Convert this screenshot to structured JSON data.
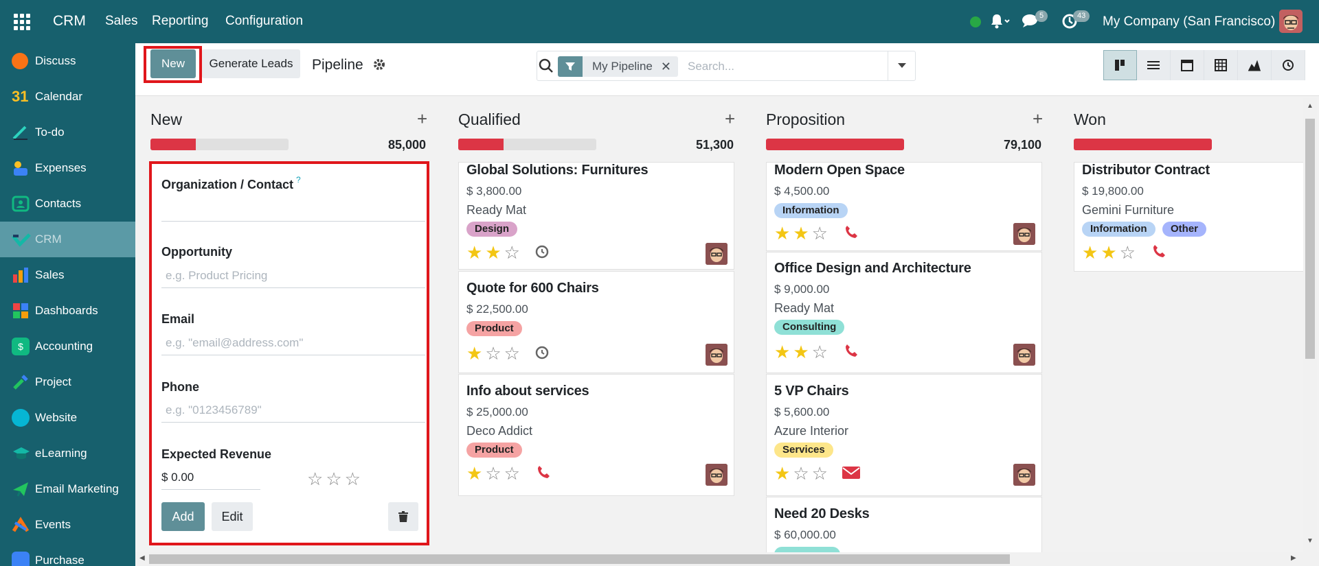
{
  "topbar": {
    "brand": "CRM",
    "menu": [
      "Sales",
      "Reporting",
      "Configuration"
    ],
    "messages_count": "5",
    "activities_count": "43",
    "company": "My Company (San Francisco)"
  },
  "sidebar": {
    "items": [
      {
        "label": "Discuss",
        "icon": "discuss-icon",
        "color": "#f97316"
      },
      {
        "label": "Calendar",
        "icon": "calendar-icon",
        "color": "#1d4ed8"
      },
      {
        "label": "To-do",
        "icon": "todo-icon",
        "color": "#14b8a6"
      },
      {
        "label": "Expenses",
        "icon": "expenses-icon",
        "color": "#3b82f6"
      },
      {
        "label": "Contacts",
        "icon": "contacts-icon",
        "color": "#10b981"
      },
      {
        "label": "CRM",
        "icon": "crm-icon",
        "color": "#14b8a6"
      },
      {
        "label": "Sales",
        "icon": "sales-icon",
        "color": "#ef4444"
      },
      {
        "label": "Dashboards",
        "icon": "dashboards-icon",
        "color": "#3b82f6"
      },
      {
        "label": "Accounting",
        "icon": "accounting-icon",
        "color": "#10b981"
      },
      {
        "label": "Project",
        "icon": "project-icon",
        "color": "#22c55e"
      },
      {
        "label": "Website",
        "icon": "website-icon",
        "color": "#06b6d4"
      },
      {
        "label": "eLearning",
        "icon": "elearning-icon",
        "color": "#14b8a6"
      },
      {
        "label": "Email Marketing",
        "icon": "email-marketing-icon",
        "color": "#22c55e"
      },
      {
        "label": "Events",
        "icon": "events-icon",
        "color": "#f97316"
      },
      {
        "label": "Purchase",
        "icon": "purchase-icon",
        "color": "#3b82f6"
      }
    ],
    "active": "CRM"
  },
  "control": {
    "new_label": "New",
    "generate_label": "Generate Leads",
    "breadcrumb": "Pipeline",
    "filter_label": "My Pipeline",
    "search_placeholder": "Search...",
    "views": [
      "kanban-view-icon",
      "list-view-icon",
      "calendar-view-icon",
      "pivot-view-icon",
      "graph-view-icon",
      "activity-view-icon"
    ]
  },
  "columns": [
    {
      "title": "New",
      "total": "85,000",
      "progress": 0.33
    },
    {
      "title": "Qualified",
      "total": "51,300",
      "progress": 0.33
    },
    {
      "title": "Proposition",
      "total": "79,100",
      "progress": 1.0
    },
    {
      "title": "Won",
      "progress": 1.0
    }
  ],
  "quick_create": {
    "org_label": "Organization / Contact",
    "org_help": "?",
    "opportunity_label": "Opportunity",
    "opportunity_placeholder": "e.g. Product Pricing",
    "email_label": "Email",
    "email_placeholder": "e.g. \"email@address.com\"",
    "phone_label": "Phone",
    "phone_placeholder": "e.g. \"0123456789\"",
    "revenue_label": "Expected Revenue",
    "revenue_value": "$ 0.00",
    "add_label": "Add",
    "edit_label": "Edit"
  },
  "cards": {
    "qualified": [
      {
        "title": "Global Solutions: Furnitures",
        "amount": "$ 3,800.00",
        "customer": "Ready Mat",
        "tags": [
          {
            "label": "Design",
            "color": "#d9a3c9"
          }
        ],
        "stars": 2,
        "activity": "clock"
      },
      {
        "title": "Quote for 600 Chairs",
        "amount": "$ 22,500.00",
        "tags": [
          {
            "label": "Product",
            "color": "#f5a3a3"
          }
        ],
        "stars": 1,
        "activity": "clock"
      },
      {
        "title": "Info about services",
        "amount": "$ 25,000.00",
        "customer": "Deco Addict",
        "tags": [
          {
            "label": "Product",
            "color": "#f5a3a3"
          }
        ],
        "stars": 1,
        "activity": "phone"
      }
    ],
    "proposition": [
      {
        "title": "Modern Open Space",
        "amount": "$ 4,500.00",
        "tags": [
          {
            "label": "Information",
            "color": "#b8d4f5"
          }
        ],
        "stars": 2,
        "activity": "phone"
      },
      {
        "title": "Office Design and Architecture",
        "amount": "$ 9,000.00",
        "customer": "Ready Mat",
        "tags": [
          {
            "label": "Consulting",
            "color": "#8fe0d6"
          }
        ],
        "stars": 2,
        "activity": "phone"
      },
      {
        "title": "5 VP Chairs",
        "amount": "$ 5,600.00",
        "customer": "Azure Interior",
        "tags": [
          {
            "label": "Services",
            "color": "#fde68a"
          }
        ],
        "stars": 1,
        "activity": "email"
      },
      {
        "title": "Need 20 Desks",
        "amount": "$ 60,000.00",
        "tags": [
          {
            "label": "",
            "color": "#8fe0d6"
          }
        ]
      }
    ],
    "won": [
      {
        "title": "Distributor Contract",
        "amount": "$ 19,800.00",
        "customer": "Gemini Furniture",
        "tags": [
          {
            "label": "Information",
            "color": "#b8d4f5"
          },
          {
            "label": "Other",
            "color": "#a5b4fc"
          }
        ],
        "stars": 2,
        "activity": "phone"
      }
    ]
  }
}
